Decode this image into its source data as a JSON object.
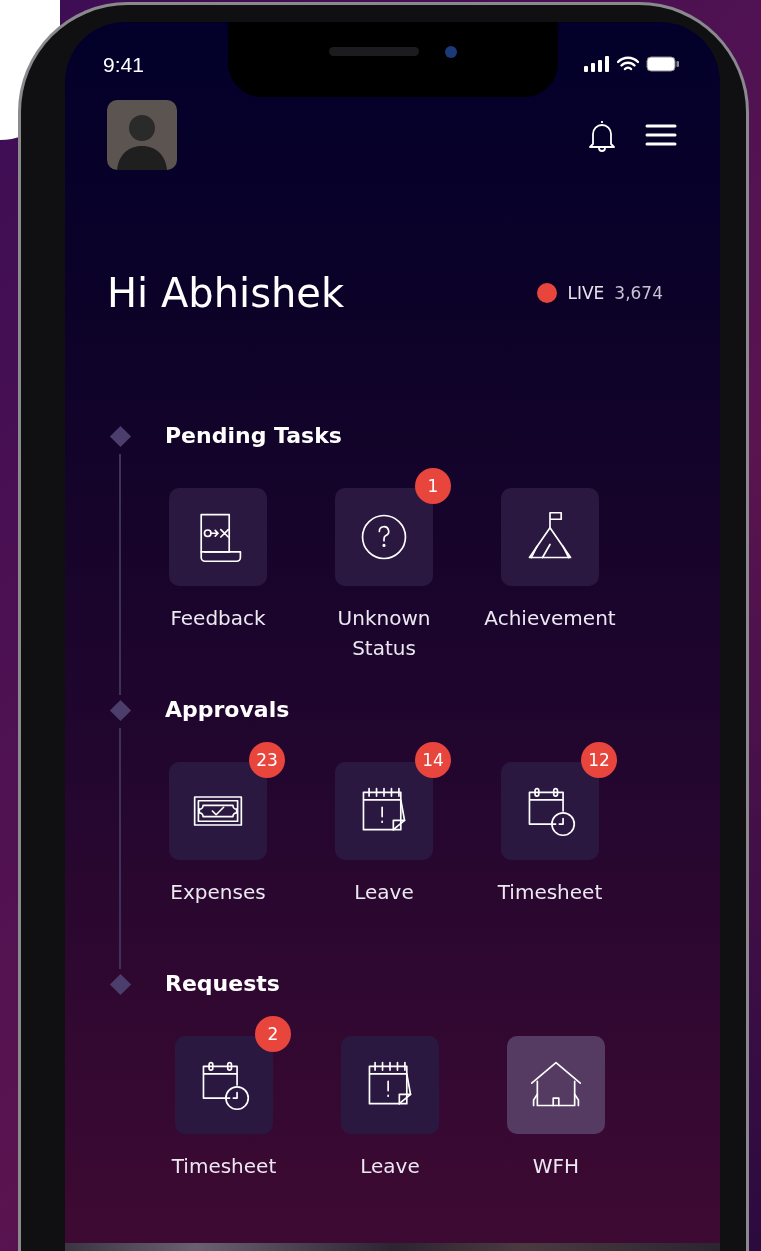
{
  "status_bar": {
    "time": "9:41"
  },
  "header": {
    "greeting": "Hi Abhishek",
    "live": {
      "label": "LIVE",
      "count": "3,674",
      "color": "#e8453c"
    }
  },
  "sections": [
    {
      "title": "Pending Tasks",
      "items": [
        {
          "kind": "feedback",
          "label": "Feedback",
          "selected": false
        },
        {
          "kind": "question",
          "label": "Unknown Status",
          "badge": "1",
          "selected": false
        },
        {
          "kind": "achievement",
          "label": "Achievement",
          "selected": false
        }
      ]
    },
    {
      "title": "Approvals",
      "items": [
        {
          "kind": "expenses",
          "label": "Expenses",
          "badge": "23",
          "selected": false
        },
        {
          "kind": "leave",
          "label": "Leave",
          "badge": "14",
          "selected": false
        },
        {
          "kind": "timesheet",
          "label": "Timesheet",
          "badge": "12",
          "selected": false
        }
      ]
    },
    {
      "title": "Requests",
      "items": [
        {
          "kind": "timesheet",
          "label": "Timesheet",
          "badge": "2",
          "selected": false
        },
        {
          "kind": "leave",
          "label": "Leave",
          "selected": false
        },
        {
          "kind": "home",
          "label": "WFH",
          "selected": true
        }
      ]
    }
  ]
}
